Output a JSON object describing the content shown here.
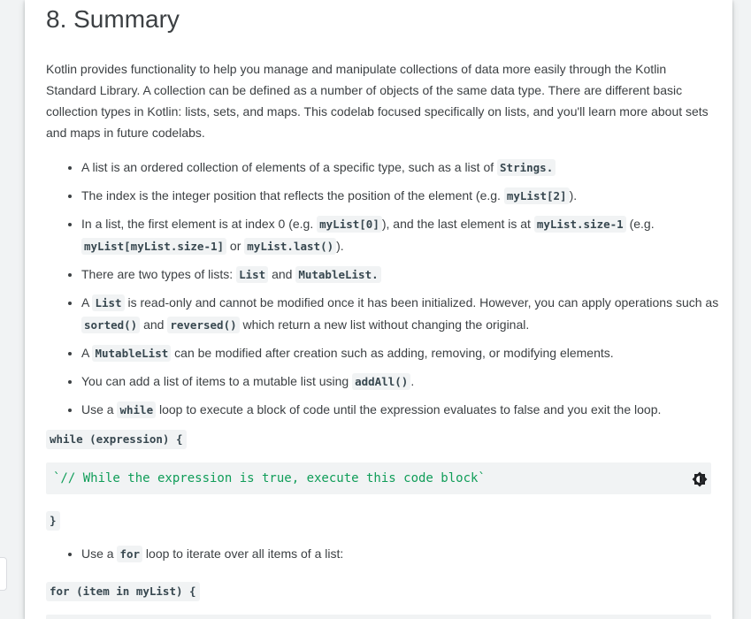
{
  "heading": "8. Summary",
  "intro": "Kotlin provides functionality to help you manage and manipulate collections of data more easily through the Kotlin Standard Library. A collection can be defined as a number of objects of the same data type. There are different basic collection types in Kotlin: lists, sets, and maps. This codelab focused specifically on lists, and you'll learn more about sets and maps in future codelabs.",
  "bullets": {
    "b1": {
      "t1": "A list is an ordered collection of elements of a specific type, such as a list of ",
      "c1": "Strings."
    },
    "b2": {
      "t1": "The index is the integer position that reflects the position of the element (e.g. ",
      "c1": "myList[2]",
      "t2": ")."
    },
    "b3": {
      "t1": "In a list, the first element is at index 0 (e.g. ",
      "c1": "myList[0]",
      "t2": "), and the last element is at ",
      "c2": "myList.size-1",
      "t3": " (e.g. ",
      "c3": "myList[myList.size-1]",
      "t4": " or ",
      "c4": "myList.last()",
      "t5": ")."
    },
    "b4": {
      "t1": "There are two types of lists: ",
      "c1": "List",
      "t2": " and ",
      "c2": "MutableList."
    },
    "b5": {
      "t1": "A ",
      "c1": "List",
      "t2": " is read-only and cannot be modified once it has been initialized. However, you can apply operations such as ",
      "c2": "sorted()",
      "t3": " and ",
      "c3": "reversed()",
      "t4": " which return a new list without changing the original."
    },
    "b6": {
      "t1": "A ",
      "c1": "MutableList",
      "t2": " can be modified after creation such as adding, removing, or modifying elements."
    },
    "b7": {
      "t1": "You can add a list of items to a mutable list using ",
      "c1": "addAll()",
      "t2": "."
    },
    "b8": {
      "t1": "Use a ",
      "c1": "while",
      "t2": " loop to execute a block of code until the expression evaluates to false and you exit the loop."
    },
    "b9": {
      "t1": "Use a ",
      "c1": "for",
      "t2": " loop to iterate over all items of a list:"
    }
  },
  "code": {
    "while_open": "while (expression) {",
    "while_comment": "`// While the expression is true, execute this code block`",
    "while_close": "}",
    "for_open": "for (item in myList) {"
  },
  "icons": {
    "theme_toggle": "brightness-contrast-icon"
  },
  "colors": {
    "comment": "#0f9d58",
    "code_bg": "#f1f3f4"
  }
}
